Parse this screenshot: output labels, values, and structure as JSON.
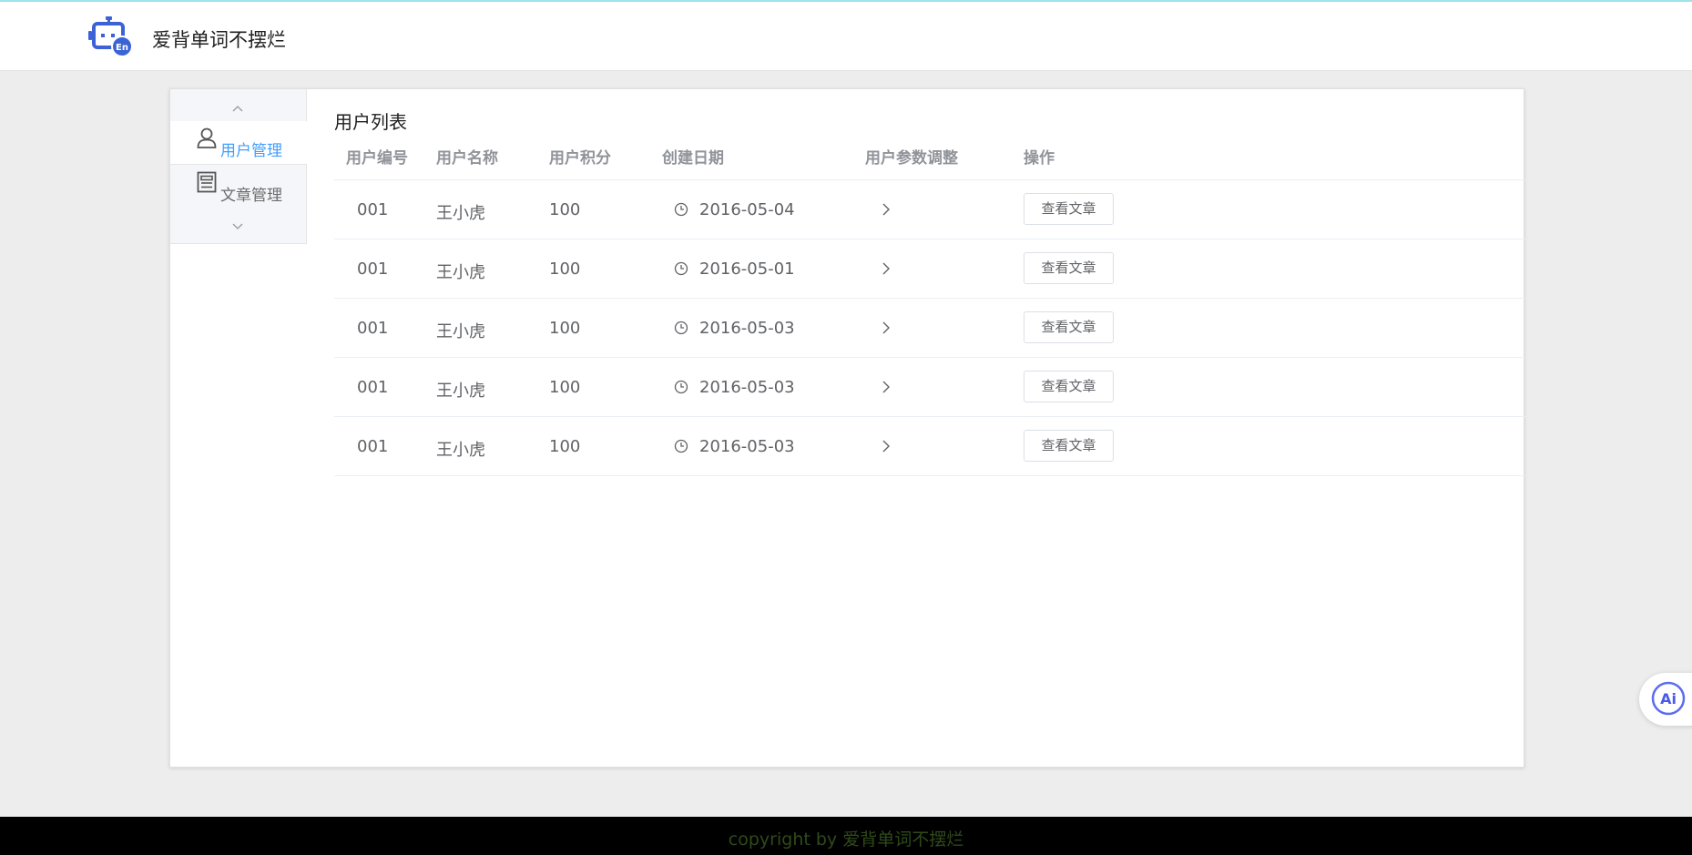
{
  "app": {
    "title": "爱背单词不摆烂"
  },
  "sidebar": {
    "items": [
      {
        "label": "用户管理",
        "icon": "user-icon",
        "active": true
      },
      {
        "label": "文章管理",
        "icon": "article-icon",
        "active": false
      }
    ]
  },
  "main": {
    "title": "用户列表",
    "table": {
      "headers": [
        "用户编号",
        "用户名称",
        "用户积分",
        "创建日期",
        "用户参数调整",
        "操作"
      ],
      "rows": [
        {
          "id": "001",
          "name": "王小虎",
          "points": "100",
          "date": "2016-05-04",
          "action": "查看文章"
        },
        {
          "id": "001",
          "name": "王小虎",
          "points": "100",
          "date": "2016-05-01",
          "action": "查看文章"
        },
        {
          "id": "001",
          "name": "王小虎",
          "points": "100",
          "date": "2016-05-03",
          "action": "查看文章"
        },
        {
          "id": "001",
          "name": "王小虎",
          "points": "100",
          "date": "2016-05-03",
          "action": "查看文章"
        },
        {
          "id": "001",
          "name": "王小虎",
          "points": "100",
          "date": "2016-05-03",
          "action": "查看文章"
        }
      ]
    }
  },
  "ai_button": {
    "label": "Ai"
  },
  "footer": {
    "text": "copyright by 爱背单词不摆烂"
  },
  "colors": {
    "accent": "#409eff",
    "logo": "#3b63d6",
    "footer_bg": "#000000",
    "footer_text": "#2f4a1a"
  }
}
